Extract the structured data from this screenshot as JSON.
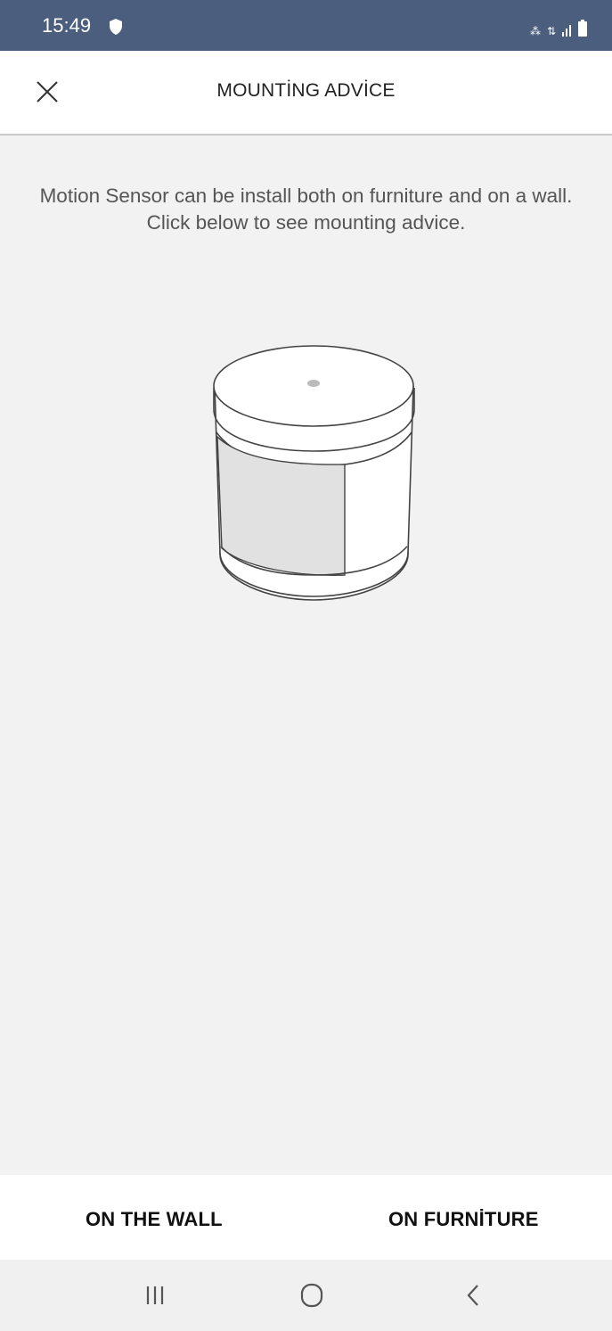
{
  "status_bar": {
    "time": "15:49",
    "left_icons": [
      "shield-icon"
    ],
    "right_icons": [
      "volte-icon",
      "4g-icon",
      "signal-icon",
      "battery-icon"
    ],
    "background": "#4b5e7e"
  },
  "header": {
    "title": "MOUNTİNG ADVİCE",
    "close_icon": "close-icon"
  },
  "main": {
    "description_line1": "Motion Sensor can be install both on furniture and on a wall.",
    "description_line2": "Click below to see mounting advice.",
    "illustration": "motion-sensor-illustration"
  },
  "actions": {
    "wall_label": "ON THE WALL",
    "furniture_label": "ON FURNİTURE"
  },
  "nav": {
    "icons": [
      "recents-icon",
      "home-icon",
      "back-icon"
    ]
  }
}
